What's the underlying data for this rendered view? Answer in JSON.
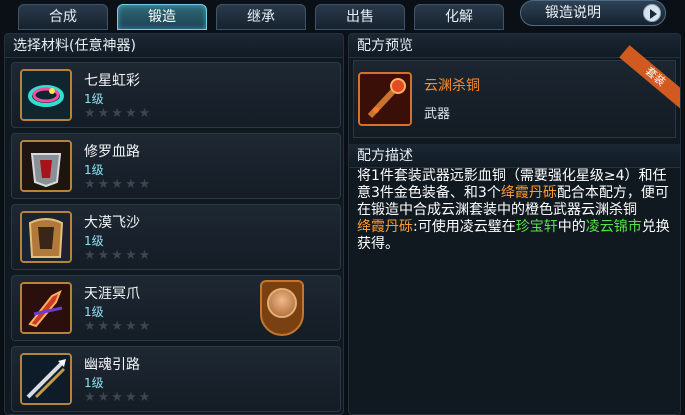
{
  "tabs": [
    {
      "label": "合成",
      "active": false
    },
    {
      "label": "锻造",
      "active": true
    },
    {
      "label": "继承",
      "active": false
    },
    {
      "label": "出售",
      "active": false
    },
    {
      "label": "化解",
      "active": false
    }
  ],
  "help_button": {
    "label": "锻造说明"
  },
  "left": {
    "title": "选择材料(任意神器)",
    "items": [
      {
        "name": "七星虹彩",
        "level": "1级",
        "stars": "★★★★★"
      },
      {
        "name": "修罗血路",
        "level": "1级",
        "stars": "★★★★★"
      },
      {
        "name": "大漠飞沙",
        "level": "1级",
        "stars": "★★★★★"
      },
      {
        "name": "天涯冥爪",
        "level": "1级",
        "stars": "★★★★★"
      },
      {
        "name": "幽魂引路",
        "level": "1级",
        "stars": "★★★★★"
      }
    ]
  },
  "right": {
    "preview_title": "配方预览",
    "recipe": {
      "name": "云渊杀铜",
      "type": "武器",
      "ribbon": "套装"
    },
    "desc_title": "配方描述",
    "desc": {
      "p1": "将1件套装武器远影血铜（需要强化星级≥4）和任意3件金色装备、和3个",
      "item_a": "绛霞丹砾",
      "p2": "配合本配方，便可在锻造中合成云渊套装中的橙色武器云渊杀铜",
      "item_b": "绛霞丹砾",
      "p3": ":可使用凌云璧在",
      "shop1": "珍宝轩",
      "p4": "中的",
      "shop2": "凌云锦市",
      "p5": "兑换获得。"
    }
  },
  "colors": {
    "accent": "#ff8a2b",
    "highlight_green": "#57e04a",
    "tab_active": "#2f6a78"
  }
}
